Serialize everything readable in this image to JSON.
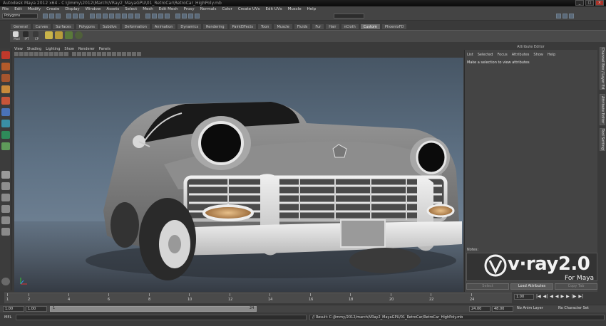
{
  "window": {
    "title": "Autodesk Maya 2012 x64 - C:\\Jimmy\\2012\\March\\VRay2_MayaGPU\\01_RetroCar\\RetroCar_HighPoly.mb",
    "controls": [
      "_",
      "□",
      "×"
    ]
  },
  "menubar": {
    "items": [
      "File",
      "Edit",
      "Modify",
      "Create",
      "Display",
      "Window",
      "Assets",
      "Select",
      "Mesh",
      "Edit Mesh",
      "Proxy",
      "Normals",
      "Color",
      "Create UVs",
      "Edit UVs",
      "Muscle",
      "Help"
    ]
  },
  "statusline": {
    "mode": "Polygons"
  },
  "shelf": {
    "tabs": [
      "General",
      "Curves",
      "Surfaces",
      "Polygons",
      "Subdivs",
      "Deformation",
      "Animation",
      "Dynamics",
      "Rendering",
      "PaintEffects",
      "Toon",
      "Muscle",
      "Fluids",
      "Fur",
      "Hair",
      "nCloth",
      "Custom",
      "PhoenixFD"
    ],
    "active_tab": "Custom",
    "icon_labels": [
      "Mod",
      "IPT",
      "CP"
    ]
  },
  "viewport": {
    "menu": [
      "View",
      "Shading",
      "Lighting",
      "Show",
      "Renderer",
      "Panels"
    ],
    "colors": {
      "top": "#475665",
      "bottom": "#7c8d9f"
    }
  },
  "attribute_editor": {
    "title": "Attribute Editor",
    "menu": [
      "List",
      "Selected",
      "Focus",
      "Attributes",
      "Show",
      "Help"
    ],
    "message": "Make a selection to view attributes",
    "notes_label": "Notes:",
    "buttons": [
      {
        "label": "Select",
        "enabled": false
      },
      {
        "label": "Load Attributes",
        "enabled": true
      },
      {
        "label": "Copy Tab",
        "enabled": false
      }
    ]
  },
  "side_tabs": [
    "Channel Box / Layer Editor",
    "Attribute Editor",
    "Tool Settings"
  ],
  "logo": {
    "main": "v·ray2.0",
    "sub": "For Maya"
  },
  "timeline": {
    "ticks": [
      1,
      2,
      4,
      6,
      8,
      10,
      12,
      14,
      16,
      18,
      20,
      22,
      24
    ],
    "current_frame": "1.00",
    "playback": [
      "|◀",
      "◀|",
      "◀",
      "◀",
      "▶",
      "▶",
      "|▶",
      "▶|"
    ]
  },
  "range": {
    "start": "1.00",
    "playback_start": "1.00",
    "slider_start": "1",
    "slider_end": "24",
    "playback_end": "24.00",
    "end": "48.00",
    "anim_layer": "No Anim Layer",
    "character_set": "No Character Set"
  },
  "command_line": {
    "language": "MEL",
    "result": "// Result: C:/Jimmy/2012/march/VRay2_MayaGPU/01_RetroCar/RetroCar_HighPoly.mb"
  }
}
